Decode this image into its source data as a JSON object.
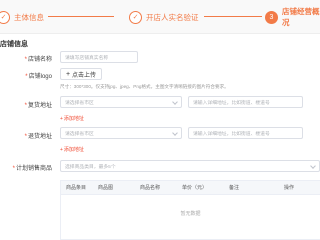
{
  "steps": [
    {
      "number": "1",
      "label": "主体信息",
      "state": "done",
      "icon": "check-icon"
    },
    {
      "number": "2",
      "label": "开店人实名验证",
      "state": "done",
      "icon": "check-icon"
    },
    {
      "number": "3",
      "label": "店铺经营概况",
      "state": "active",
      "icon": ""
    }
  ],
  "section": {
    "title": "店铺信息"
  },
  "form": {
    "shop_name": {
      "label": "店铺名称",
      "placeholder": "请填写店铺真实名称"
    },
    "shop_logo": {
      "label": "店铺logo",
      "upload_label": "点击上传",
      "hint": "尺寸：300*300。仅支持jpg、jpeg、Png格式，主图文字清晰链接的图片符合要求。"
    },
    "address_1": {
      "label": "复货地址",
      "select_placeholder": "请选择省市区",
      "detail_placeholder": "请输入详细地址，比如街道、楼道号",
      "add_label": "添加地址"
    },
    "address_2": {
      "label": "退货地址",
      "select_placeholder": "请选择省市区",
      "detail_placeholder": "请输入详细地址，比如街道、楼道号",
      "add_label": "添加地址"
    },
    "plan_goods": {
      "label": "计划销售商品",
      "placeholder": "选择商品类目，最多5个"
    }
  },
  "table": {
    "columns": [
      "商品条目",
      "商品图",
      "商品名称",
      "单价（元）",
      "备注",
      "操作"
    ],
    "empty_text": "暂无数据"
  },
  "colors": {
    "accent": "#f27b48",
    "required": "#f0472f"
  }
}
